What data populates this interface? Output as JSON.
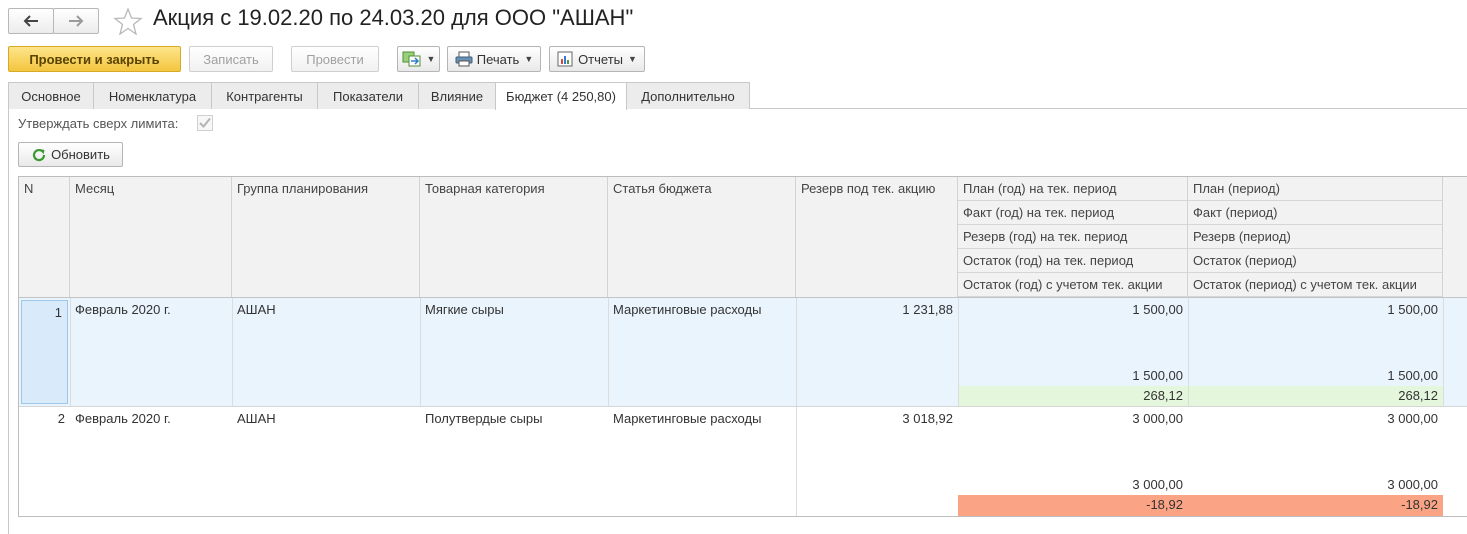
{
  "window": {
    "title": "Акция с 19.02.20 по 24.03.20 для ООО \"АШАН\""
  },
  "toolbar": {
    "post_close": "Провести и закрыть",
    "save": "Записать",
    "post": "Провести",
    "print": "Печать",
    "reports": "Отчеты"
  },
  "tabs": [
    {
      "label": "Основное"
    },
    {
      "label": "Номенклатура"
    },
    {
      "label": "Контрагенты"
    },
    {
      "label": "Показатели"
    },
    {
      "label": "Влияние"
    },
    {
      "label": "Бюджет (4 250,80)"
    },
    {
      "label": "Дополнительно"
    }
  ],
  "form": {
    "approve_over_limit_label": "Утверждать сверх лимита:",
    "approve_over_limit": true,
    "refresh": "Обновить"
  },
  "colors": {
    "selected_row": "#eaf4fd",
    "positive_balance": "#e4f6dc",
    "negative_balance": "#fba485",
    "primary_button": "#f5ca48"
  },
  "table": {
    "headers": {
      "n": "N",
      "month": "Месяц",
      "group": "Группа планирования",
      "category": "Товарная категория",
      "article": "Статья бюджета",
      "reserve": "Резерв под тек. акцию",
      "year": [
        "План (год) на тек. период",
        "Факт (год)  на тек. период",
        "Резерв (год) на тек. период",
        "Остаток (год) на тек. период",
        "Остаток (год) с учетом тек. акции"
      ],
      "period": [
        "План (период)",
        "Факт (период)",
        "Резерв (период)",
        "Остаток (период)",
        "Остаток (период) с учетом тек. акции"
      ]
    },
    "rows": [
      {
        "n": "1",
        "month": "Февраль 2020 г.",
        "group": "АШАН",
        "category": "Мягкие сыры",
        "article": "Маркетинговые расходы",
        "reserve": "1 231,88",
        "year": [
          "1 500,00",
          "",
          "",
          "1 500,00",
          "268,12"
        ],
        "period": [
          "1 500,00",
          "",
          "",
          "1 500,00",
          "268,12"
        ]
      },
      {
        "n": "2",
        "month": "Февраль 2020 г.",
        "group": "АШАН",
        "category": "Полутвердые сыры",
        "article": "Маркетинговые расходы",
        "reserve": "3 018,92",
        "year": [
          "3 000,00",
          "",
          "",
          "3 000,00",
          "-18,92"
        ],
        "period": [
          "3 000,00",
          "",
          "",
          "3 000,00",
          "-18,92"
        ]
      }
    ]
  }
}
